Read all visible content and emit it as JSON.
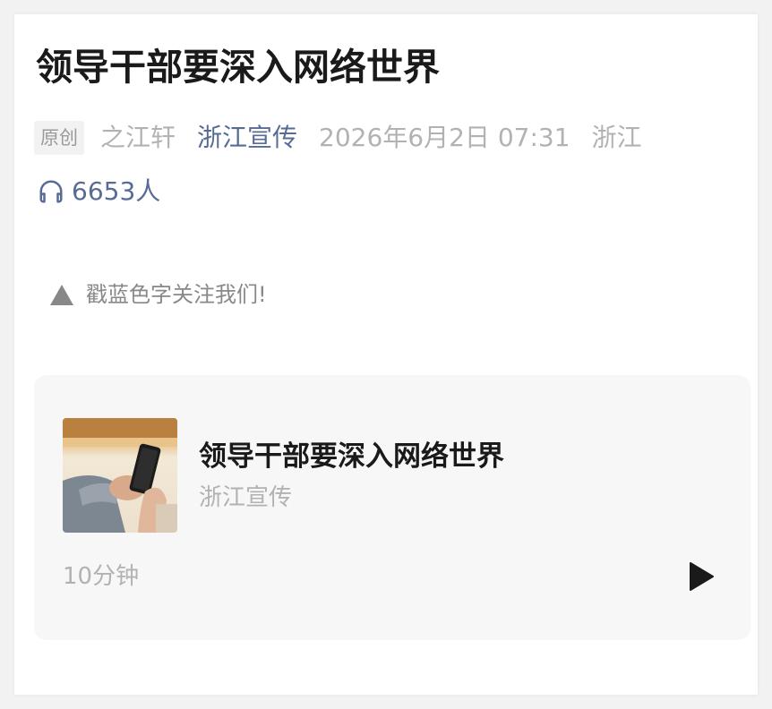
{
  "article": {
    "title": "领导干部要深入网络世界",
    "badge": "原创",
    "author": "之江轩",
    "account": "浙江宣传",
    "date": "2026年6月2日 07:31",
    "location": "浙江",
    "listen_count": "6653人",
    "follow_text": "戳蓝色字关注我们!"
  },
  "audio_card": {
    "title": "领导干部要深入网络世界",
    "source": "浙江宣传",
    "duration": "10分钟"
  },
  "icons": {
    "listen": "headphones-icon",
    "follow": "triangle-up-icon",
    "play": "play-icon"
  },
  "colors": {
    "link": "#576b95",
    "muted": "#b2b2b2",
    "card_bg": "#f7f7f7"
  }
}
